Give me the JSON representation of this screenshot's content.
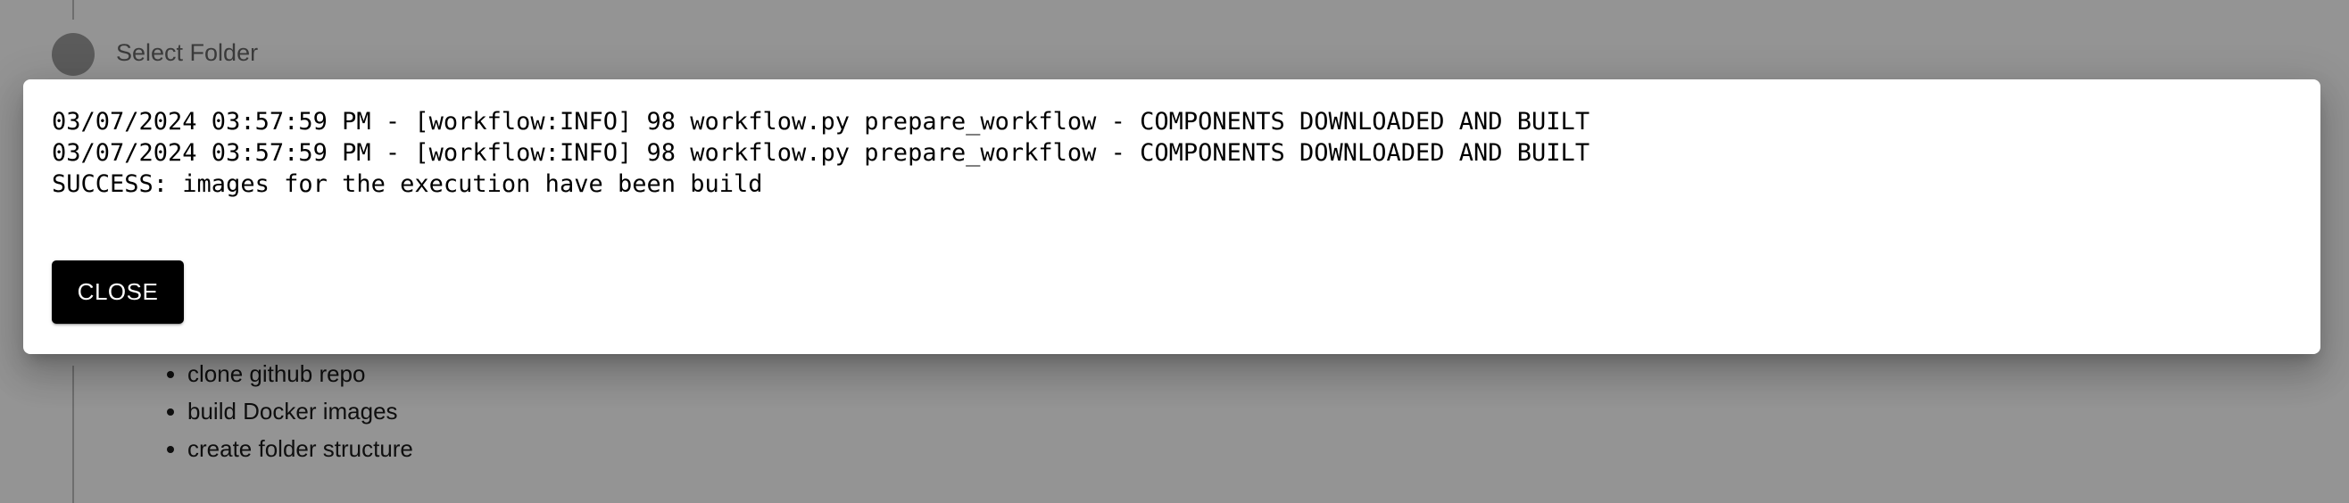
{
  "stepper": {
    "step_label": "Select Folder"
  },
  "task_list": {
    "items": [
      "clone github repo",
      "build Docker images",
      "create folder structure"
    ]
  },
  "dialog": {
    "log_lines": [
      "03/07/2024 03:57:59 PM - [workflow:INFO] 98 workflow.py prepare_workflow - COMPONENTS DOWNLOADED AND BUILT",
      "03/07/2024 03:57:59 PM - [workflow:INFO] 98 workflow.py prepare_workflow - COMPONENTS DOWNLOADED AND BUILT",
      "SUCCESS: images for the execution have been build"
    ],
    "close_label": "CLOSE"
  },
  "colors": {
    "backdrop": "#000000",
    "button_bg": "#000000",
    "button_text": "#ffffff",
    "step_circle": "#9e9e9e"
  }
}
